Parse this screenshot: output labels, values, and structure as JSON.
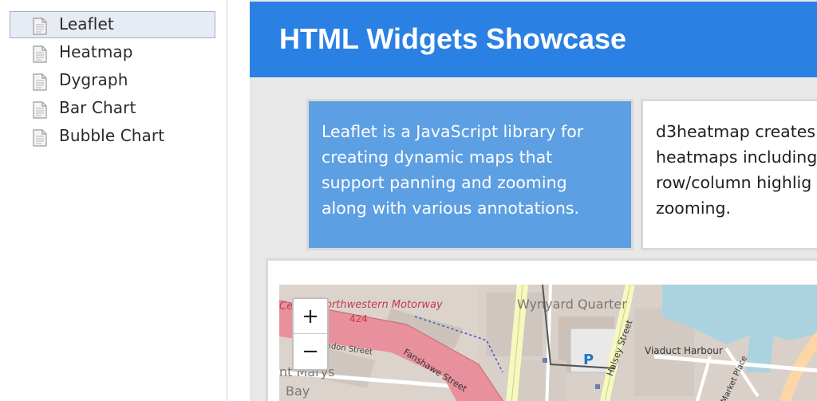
{
  "sidebar": {
    "items": [
      {
        "label": "Leaflet",
        "selected": true,
        "icon": "document-icon"
      },
      {
        "label": "Heatmap",
        "selected": false,
        "icon": "document-icon"
      },
      {
        "label": "Dygraph",
        "selected": false,
        "icon": "document-icon"
      },
      {
        "label": "Bar Chart",
        "selected": false,
        "icon": "document-icon"
      },
      {
        "label": "Bubble Chart",
        "selected": false,
        "icon": "document-icon"
      }
    ]
  },
  "header": {
    "title": "HTML Widgets Showcase"
  },
  "cards": [
    {
      "text": " Leaflet is a JavaScript library for\ncreating dynamic maps that\nsupport panning and zooming\nalong with various annotations."
    },
    {
      "text": "d3heatmap creates\nheatmaps including\nrow/column highlig\nzooming."
    }
  ],
  "map": {
    "zoom_in": "+",
    "zoom_out": "−",
    "labels": {
      "motorway": "orthwestern Motorway",
      "route": "424",
      "ce": "Ce",
      "wynyard": "Wynyard Quarter",
      "fanshawe": "Fanshawe Street",
      "london": "London Street",
      "halsey": "Halsey Street",
      "viaduct": "Viaduct Harbour",
      "market": "Market Place",
      "parking": "P",
      "stmarys": "nt Marys",
      "bay": "Bay"
    }
  },
  "colors": {
    "banner": "#2b80e4",
    "card_leaflet": "#5d9fe3",
    "sidebar_selected": "#e7ebf3",
    "motorway": "#e8909c",
    "water": "#aad3df",
    "road_yellow": "#f6f9be"
  }
}
